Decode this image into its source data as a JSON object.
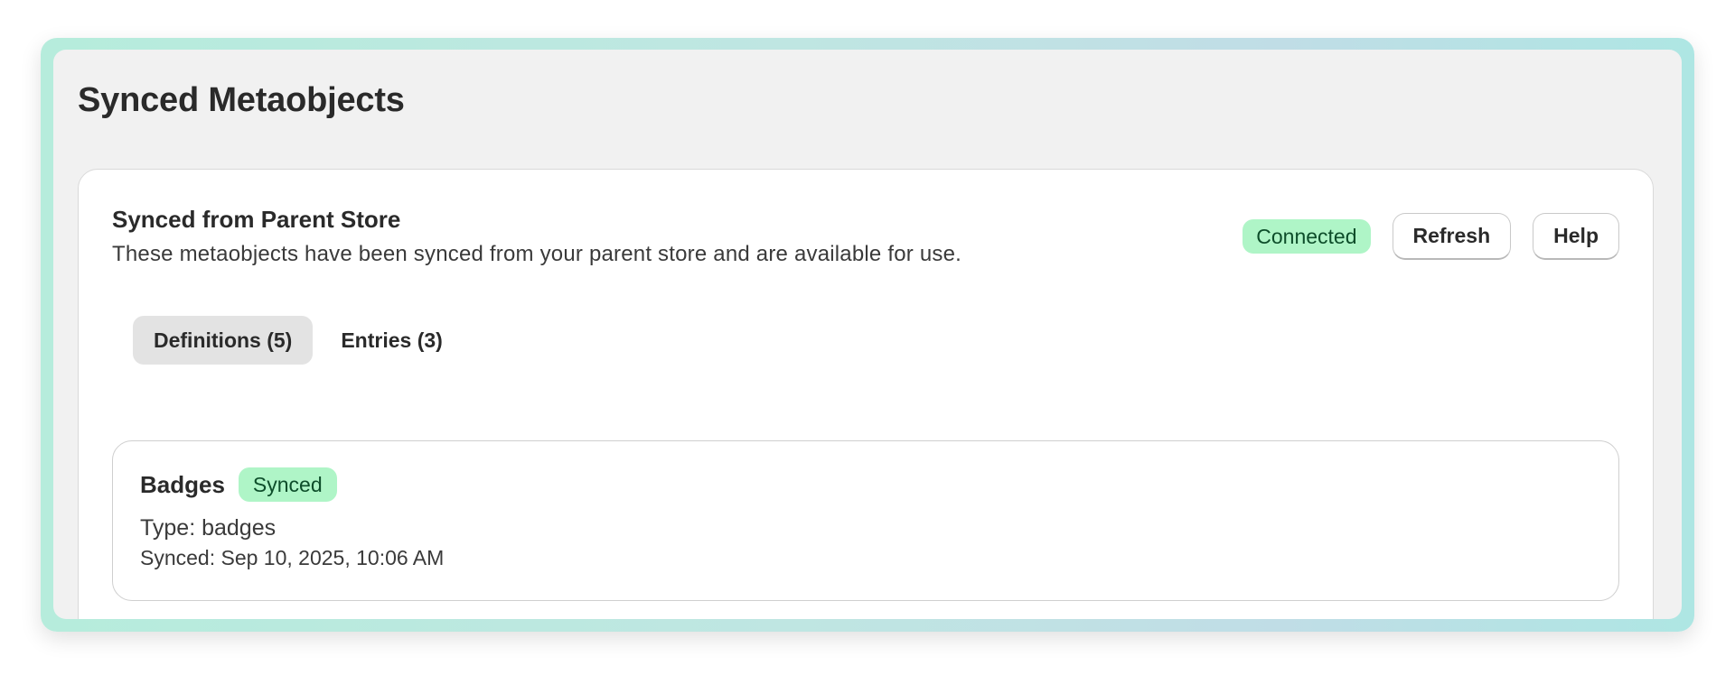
{
  "page": {
    "title": "Synced Metaobjects"
  },
  "sync_card": {
    "heading": "Synced from Parent Store",
    "description": "These metaobjects have been synced from your parent store and are available for use.",
    "status_badge": "Connected",
    "refresh_label": "Refresh",
    "help_label": "Help"
  },
  "tabs": [
    {
      "label": "Definitions (5)",
      "active": true
    },
    {
      "label": "Entries (3)",
      "active": false
    }
  ],
  "definitions": [
    {
      "name": "Badges",
      "status": "Synced",
      "type": "Type: badges",
      "synced_at": "Synced: Sep 10, 2025, 10:06 AM"
    }
  ],
  "colors": {
    "badge_bg": "#aff5c7",
    "badge_text": "#0d4d2a",
    "frame_gradient_start": "#b6ecdc",
    "frame_gradient_end": "#aee6e3"
  }
}
